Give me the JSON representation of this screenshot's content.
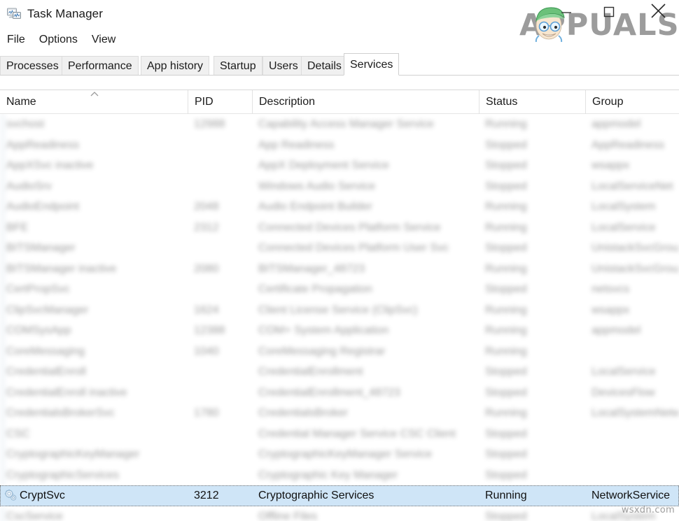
{
  "window": {
    "title": "Task Manager",
    "icon": "task-manager-monitor-icon",
    "controls": {
      "minimize": "Minimize",
      "maximize": "Maximize",
      "close": "Close"
    }
  },
  "menu": {
    "items": [
      {
        "label": "File"
      },
      {
        "label": "Options"
      },
      {
        "label": "View"
      }
    ]
  },
  "tabs": {
    "active": "Services",
    "items": [
      {
        "label": "Processes",
        "active": false
      },
      {
        "label": "Performance",
        "active": false
      },
      {
        "label": "App history",
        "active": false
      },
      {
        "label": "Startup",
        "active": false
      },
      {
        "label": "Users",
        "active": false
      },
      {
        "label": "Details",
        "active": false
      },
      {
        "label": "Services",
        "active": true
      }
    ]
  },
  "table": {
    "sort": {
      "column": "Name",
      "direction": "ascending",
      "caret": "caret-up-icon"
    },
    "columns": [
      {
        "key": "name",
        "label": "Name"
      },
      {
        "key": "pid",
        "label": "PID"
      },
      {
        "key": "desc",
        "label": "Description"
      },
      {
        "key": "status",
        "label": "Status"
      },
      {
        "key": "group",
        "label": "Group"
      }
    ],
    "selected_row": {
      "name": "CryptSvc",
      "pid": "3212",
      "desc": "Cryptographic Services",
      "status": "Running",
      "group": "NetworkService",
      "icon": "service-gears-icon"
    },
    "obscured_rows_above": 18,
    "obscured_rows_below": 1,
    "obscured_note": "blurred"
  },
  "watermarks": {
    "logo_text": "APPUALS",
    "site": "wsxdn.com"
  },
  "colors": {
    "selection": "#cfe5f7",
    "tab_inactive": "#f0f0f0",
    "tab_active": "#ffffff",
    "border": "#d9d9d9",
    "text": "#1b1b1b",
    "watermark_gray": "#9a9a9a"
  }
}
